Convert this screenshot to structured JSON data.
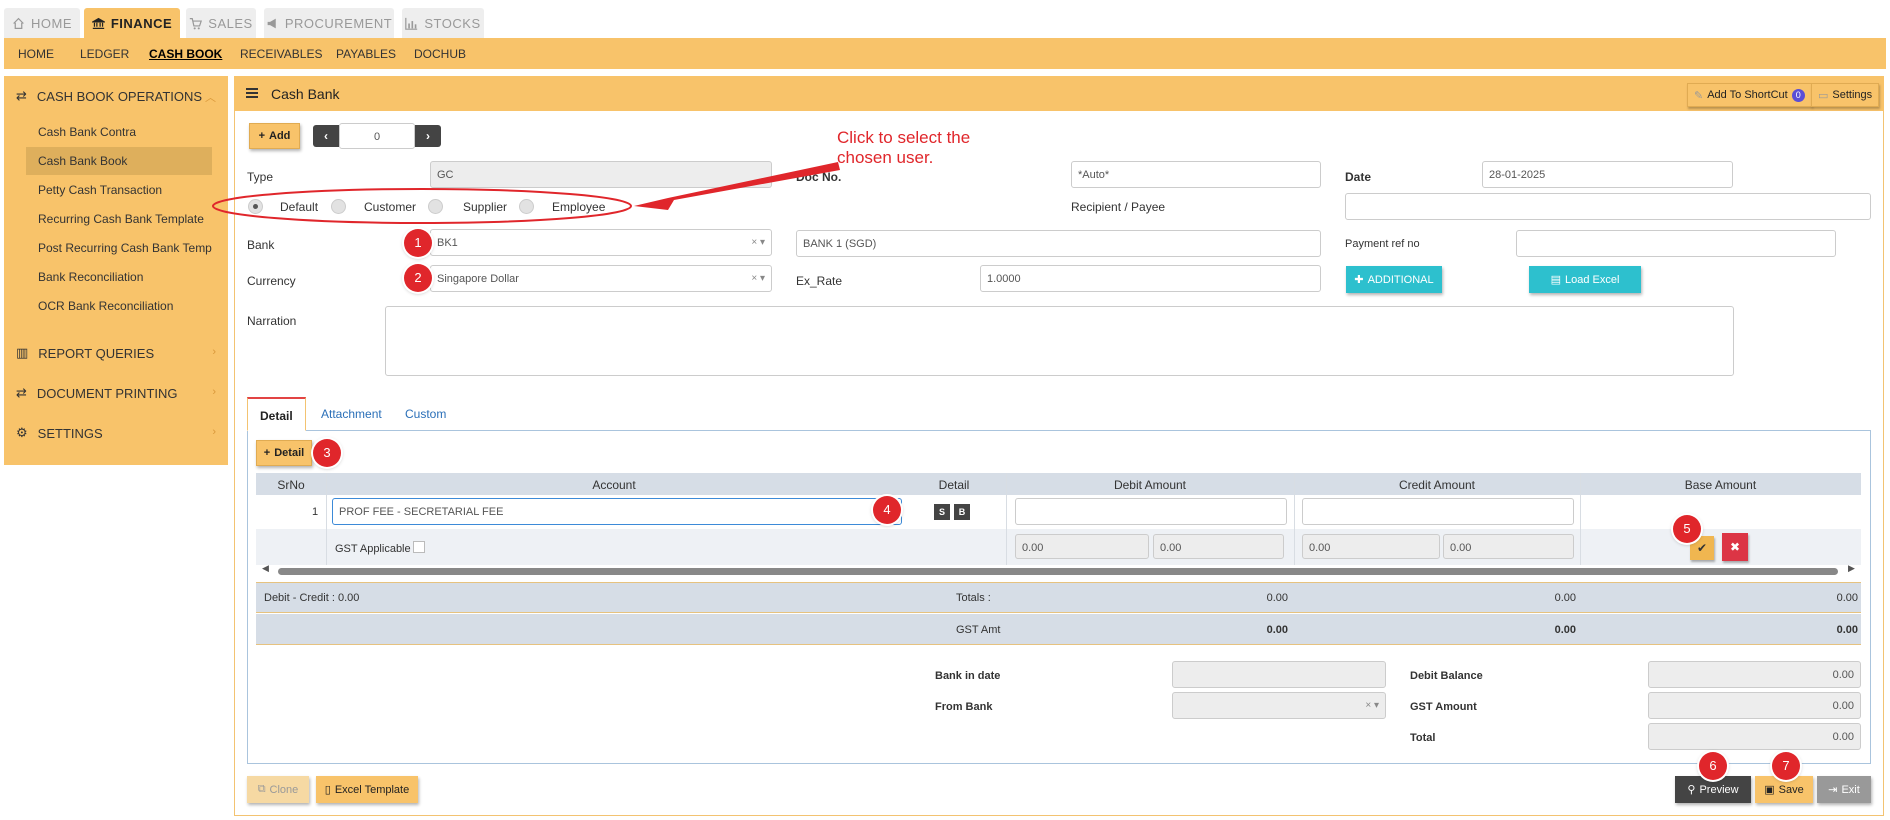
{
  "module_tabs": [
    {
      "label": "HOME",
      "icon": "home-icon"
    },
    {
      "label": "FINANCE",
      "icon": "bank-icon",
      "active": true
    },
    {
      "label": "SALES",
      "icon": "cart-icon"
    },
    {
      "label": "PROCUREMENT",
      "icon": "megaphone-icon"
    },
    {
      "label": "STOCKS",
      "icon": "chart-icon"
    }
  ],
  "sub_nav": [
    "HOME",
    "LEDGER",
    "CASH BOOK",
    "RECEIVABLES",
    "PAYABLES",
    "DOCHUB"
  ],
  "sidebar": {
    "section1": "CASH BOOK OPERATIONS",
    "items": [
      "Cash Bank Contra",
      "Cash Bank Book",
      "Petty Cash Transaction",
      "Recurring Cash Bank Template",
      "Post Recurring Cash Bank Templ...",
      "Bank Reconciliation",
      "OCR Bank Reconciliation"
    ],
    "section2": "REPORT QUERIES",
    "section3": "DOCUMENT PRINTING",
    "section4": "SETTINGS"
  },
  "header": {
    "title": "Cash Bank",
    "add_shortcut": "Add To ShortCut",
    "shortcut_count": "0",
    "settings": "Settings"
  },
  "toolbar": {
    "add": "Add",
    "record_no": "0"
  },
  "annotation": {
    "line1": "Click to select the",
    "line2": "chosen user."
  },
  "form": {
    "type_label": "Type",
    "type_value": "GC",
    "docno_label": "Doc No.",
    "docno_value": "*Auto*",
    "date_label": "Date",
    "date_value": "28-01-2025",
    "radio": [
      "Default",
      "Customer",
      "Supplier",
      "Employee"
    ],
    "recipient_label": "Recipient / Payee",
    "bank_label": "Bank",
    "bank_value": "BK1",
    "bank_name": "BANK 1 (SGD)",
    "payref_label": "Payment ref no",
    "currency_label": "Currency",
    "currency_value": "Singapore Dollar",
    "exrate_label": "Ex_Rate",
    "exrate_value": "1.0000",
    "additional": "ADDITIONAL",
    "load_excel": "Load Excel",
    "narration_label": "Narration"
  },
  "tabs": [
    "Detail",
    "Attachment",
    "Custom"
  ],
  "detail_btn": "Detail",
  "grid": {
    "headers": [
      "SrNo",
      "Account",
      "Detail",
      "Debit Amount",
      "Credit Amount",
      "Base Amount"
    ],
    "row": {
      "srno": "1",
      "account": "PROF FEE - SECRETARIAL FEE",
      "s": "S",
      "b": "B"
    },
    "gst_label": "GST Applicable",
    "gst_values": [
      "0.00",
      "0.00",
      "0.00",
      "0.00"
    ]
  },
  "totals": {
    "diff": "Debit - Credit : 0.00",
    "totals_label": "Totals :",
    "totals": [
      "0.00",
      "0.00",
      "0.00"
    ],
    "gst_label": "GST Amt",
    "gst": [
      "0.00",
      "0.00",
      "0.00"
    ]
  },
  "summary": {
    "bank_in_date": "Bank in date",
    "from_bank": "From Bank",
    "debit_balance": "Debit Balance",
    "debit_balance_value": "0.00",
    "gst_amount": "GST Amount",
    "gst_amount_value": "0.00",
    "total": "Total",
    "total_value": "0.00"
  },
  "footer": {
    "clone": "Clone",
    "excel_template": "Excel Template",
    "preview": "Preview",
    "save": "Save",
    "exit": "Exit"
  },
  "markers": [
    "1",
    "2",
    "3",
    "4",
    "5",
    "6",
    "7"
  ]
}
